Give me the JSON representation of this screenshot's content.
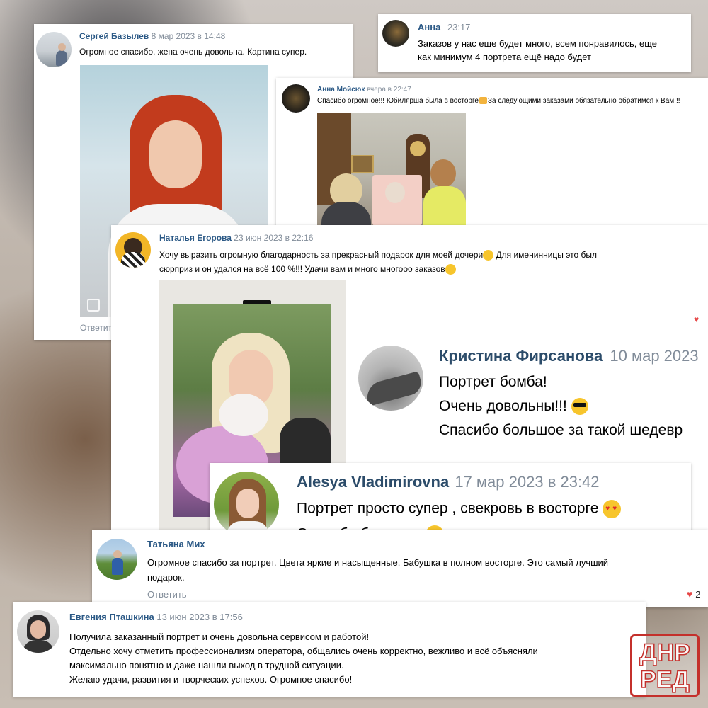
{
  "comments": {
    "sergey": {
      "author": "Сергей Базылев",
      "date": "8 мар 2023 в 14:48",
      "text": "Огромное спасибо, жена очень довольна. Картина супер.",
      "reply": "Ответить"
    },
    "anna": {
      "author": "Анна",
      "date": "23:17",
      "text": "Заказов у нас еще будет много, всем понравилось, еще\nкак минимум 4 портрета ещё надо будет"
    },
    "anna_moysyuk": {
      "author": "Анна Мойсюк",
      "date": "вчера в 22:47",
      "text": "Спасибо огромное!!! Юбилярша была в восторге",
      "text_after": "За следующими заказами обязательно обратимся к Вам!!!"
    },
    "natalya": {
      "author": "Наталья Егорова",
      "date": "23 июн 2023 в 22:16",
      "text1": "Хочу выразить огромную благодарность за прекрасный подарок для моей дочери",
      "text2": " Для именинницы это был",
      "text3": "сюрприз и он удался на всё 100 %!!! Удачи вам и много многооо заказов"
    },
    "kristina": {
      "author": "Кристина Фирсанова",
      "date": "10 мар 2023",
      "line1": "Портрет бомба!",
      "line2": "Очень довольны!!!",
      "line3": "Спасибо большое за такой шедевр"
    },
    "alesya": {
      "author": "Alesya Vladimirovna",
      "date": "17 мар 2023 в 23:42",
      "line1": "Портрет просто супер , свекровь в восторге",
      "line2": "Спасибо большое"
    },
    "tatyana": {
      "author": "Татьяна Мих",
      "text": "Огромное спасибо за портрет. Цвета яркие и насыщенные. Бабушка в полном восторге. Это самый лучший\nподарок.",
      "reply": "Ответить",
      "likes": "2"
    },
    "evgeniya": {
      "author": "Евгения Пташкина",
      "date": "13 июн 2023 в 17:56",
      "text": "Получила заказанный портрет и очень довольна сервисом и работой!\nОтдельно хочу отметить профессионализм оператора, общались очень корректно, вежливо и всё объясняли\nмаксимально понятно и даже нашли выход в трудной ситуации.\nЖелаю удачи, развития и творческих успехов. Огромное спасибо!"
    }
  },
  "watermark": {
    "line1": "ДНР",
    "line2": "РЕД"
  },
  "icons": {
    "heart": "heart-icon",
    "photo_count": "photo-count-icon"
  },
  "colors": {
    "author": "#2a5885",
    "date": "#818c99",
    "heart": "#e64646",
    "watermark": "#c4302b"
  }
}
